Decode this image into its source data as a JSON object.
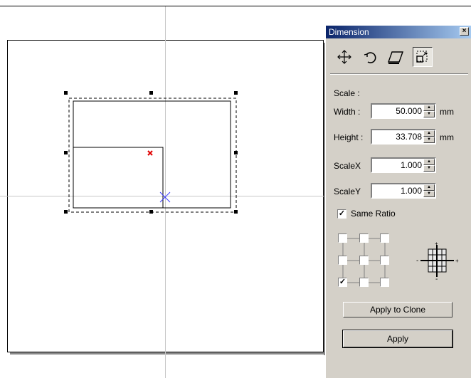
{
  "panel": {
    "title": "Dimension",
    "close_glyph": "×",
    "tools": [
      {
        "name": "move-icon",
        "active": false
      },
      {
        "name": "rotate-icon",
        "active": false
      },
      {
        "name": "skew-icon",
        "active": false
      },
      {
        "name": "scale-icon",
        "active": true
      }
    ],
    "scale_heading": "Scale :",
    "width": {
      "label": "Width :",
      "value": "50.000",
      "unit": "mm"
    },
    "height": {
      "label": "Height :",
      "value": "33.708",
      "unit": "mm"
    },
    "scale_x": {
      "label": "ScaleX",
      "value": "1.000"
    },
    "scale_y": {
      "label": "ScaleY",
      "value": "1.000"
    },
    "same_ratio": {
      "label": "Same Ratio",
      "checked": true,
      "mark": "✓"
    },
    "anchor_grid": {
      "checked_index": 6
    },
    "apply_to_clone_label": "Apply to Clone",
    "apply_label": "Apply"
  },
  "colors": {
    "titlebar_start": "#0a246a",
    "titlebar_end": "#a6caf0",
    "panel_bg": "#d4d0c8",
    "marker_red": "#e00000",
    "marker_blue": "#3a3aff"
  }
}
